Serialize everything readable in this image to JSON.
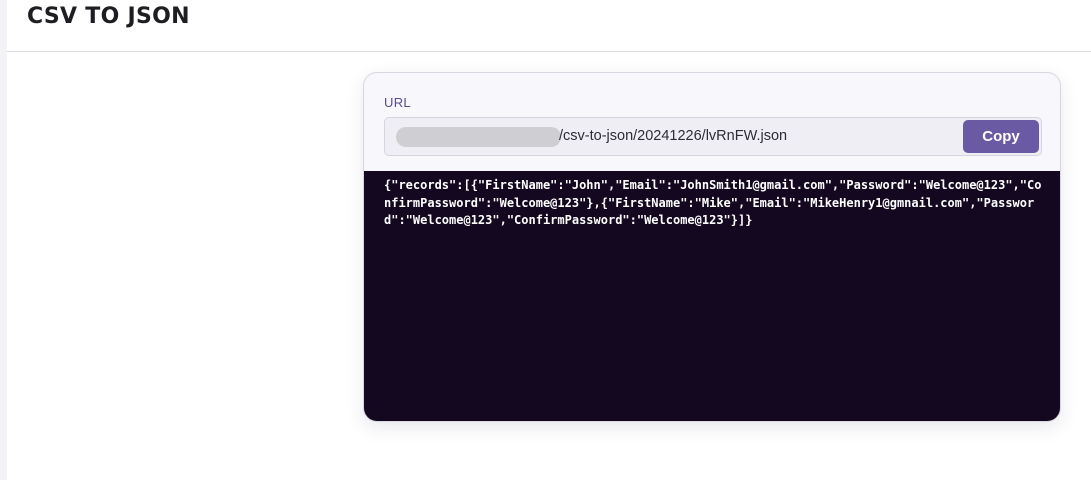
{
  "header": {
    "title": "CSV TO JSON"
  },
  "result": {
    "url_label": "URL",
    "url_value": "/csv-to-json/20241226/lvRnFW.json",
    "copy_label": "Copy",
    "json_output": "{\"records\":[{\"FirstName\":\"John\",\"Email\":\"JohnSmith1@gmail.com\",\"Password\":\"Welcome@123\",\"ConfirmPassword\":\"Welcome@123\"},{\"FirstName\":\"Mike\",\"Email\":\"MikeHenry1@gmnail.com\",\"Password\":\"Welcome@123\",\"ConfirmPassword\":\"Welcome@123\"}]}"
  },
  "colors": {
    "accent": "#6a5aa3",
    "output_background": "#13081f",
    "label": "#5b4b8a"
  }
}
